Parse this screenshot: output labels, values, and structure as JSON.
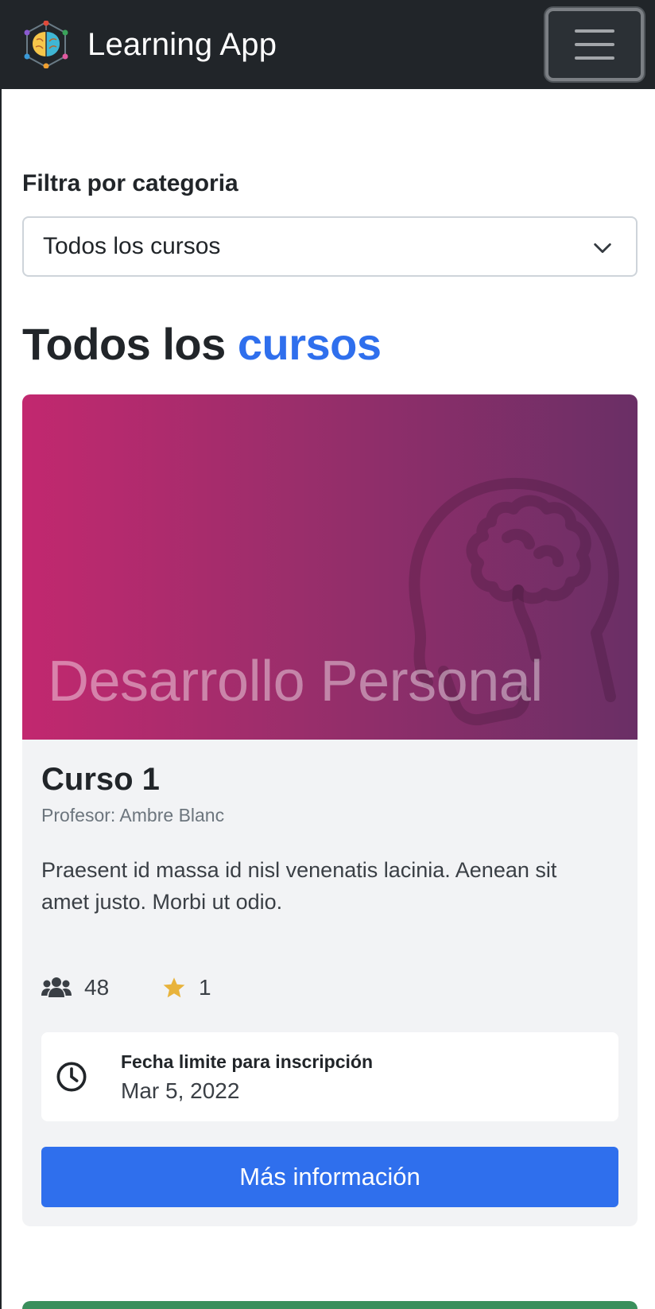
{
  "navbar": {
    "brand_title": "Learning App",
    "toggler_icon": "hamburger-menu-icon",
    "logo_icon": "brain-network-logo"
  },
  "filter": {
    "label": "Filtra por categoria",
    "selected": "Todos los cursos"
  },
  "heading": {
    "part1": "Todos los ",
    "accent": "cursos"
  },
  "course_card": {
    "category_banner": "Desarrollo Personal",
    "banner_icon": "head-brain-icon",
    "title": "Curso 1",
    "teacher": "Profesor: Ambre Blanc",
    "description": "Praesent id massa id nisl venenatis lacinia. Aenean sit amet justo. Morbi ut odio.",
    "students": "48",
    "rating": "1",
    "deadline_label": "Fecha limite para inscripción",
    "deadline_date": "Mar 5, 2022",
    "button_label": "Más información"
  },
  "colors": {
    "navbar_bg": "#212529",
    "accent_blue": "#2f6fed",
    "banner_start": "#c2286f",
    "banner_end": "#6a2f66",
    "star": "#e8b33c",
    "next_card": "#3a8f5c"
  }
}
